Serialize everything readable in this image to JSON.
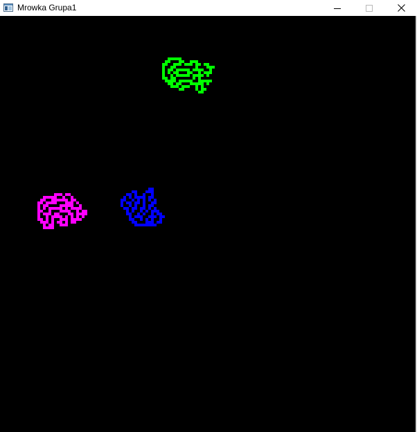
{
  "window": {
    "title": "Mrowka Grupa1",
    "app_icon": "window-app-icon",
    "controls": {
      "minimize_icon": "minimize-icon",
      "maximize_icon": "maximize-icon",
      "close_icon": "close-icon"
    }
  },
  "canvas": {
    "background": "#000000",
    "ant_groups": [
      {
        "name": "green-group",
        "color": "#00ff00"
      },
      {
        "name": "magenta-group",
        "color": "#ff00ff"
      },
      {
        "name": "blue-group",
        "color": "#0000ff"
      }
    ]
  }
}
